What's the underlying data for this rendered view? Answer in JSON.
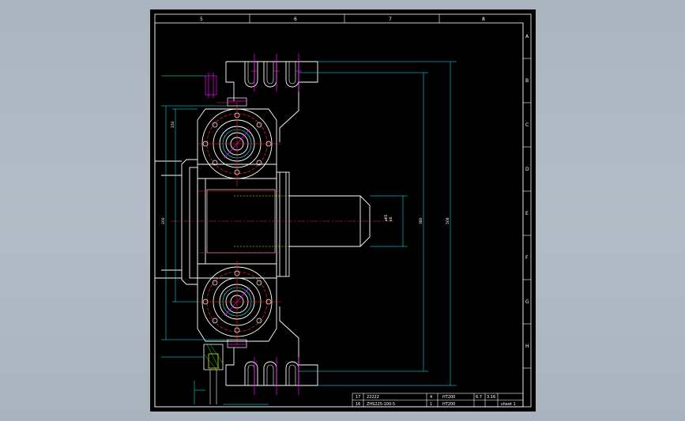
{
  "sheet": {
    "zones_top": [
      "5",
      "6",
      "7",
      "8"
    ],
    "zones_right": [
      "A",
      "B",
      "C",
      "D",
      "E",
      "F",
      "G",
      "H"
    ]
  },
  "dimensions": {
    "shaft_dia": "ø65",
    "shaft_fit": "k6",
    "width_outer": "508",
    "width_inner": "380",
    "height_a": "150",
    "height_b": "200"
  },
  "title_block": {
    "row1": {
      "index": "17",
      "code": "22222",
      "qty": "4",
      "material": "HT200",
      "weight": "6.7",
      "note": "3.16"
    },
    "row2": {
      "index": "16",
      "code": "ZHS225-100-5",
      "qty": "1",
      "material": "HT200",
      "sheet": "sheet 1"
    }
  },
  "colors": {
    "outline": "#ffffff",
    "dimension": "#00ffff",
    "center": "#ff2020",
    "hidden": "#ffff00",
    "bolt": "#ff00ff",
    "hatch": "#00ff00",
    "frame": "#ffffff"
  }
}
